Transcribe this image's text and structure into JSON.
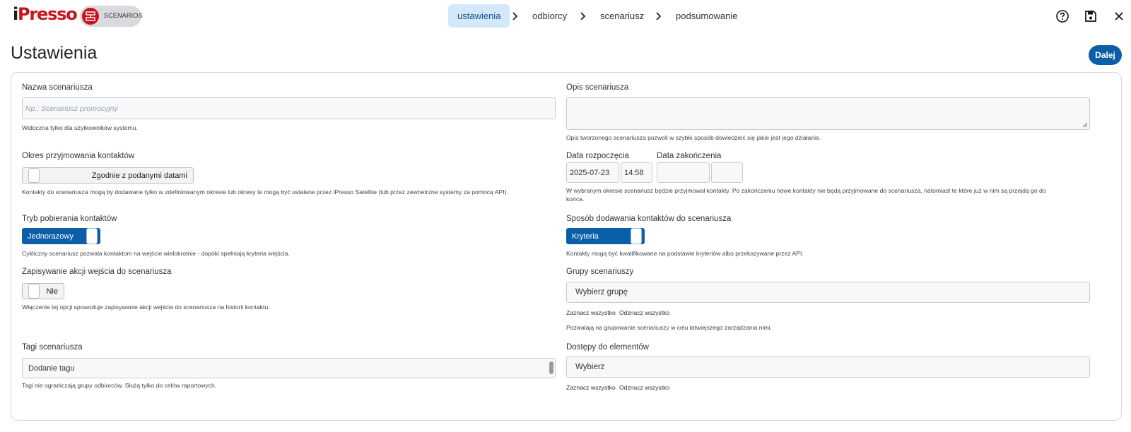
{
  "header": {
    "logo_i": "i",
    "logo_text": "Presso",
    "badge_label": "SCENARIOS",
    "steps": [
      {
        "label": "ustawienia",
        "active": true
      },
      {
        "label": "odbiorcy",
        "active": false
      },
      {
        "label": "scenariusz",
        "active": false
      },
      {
        "label": "podsumowanie",
        "active": false
      }
    ],
    "icons": [
      "help-icon",
      "save-icon",
      "close-icon"
    ]
  },
  "page": {
    "title": "Ustawienia",
    "next_label": "Dalej"
  },
  "form": {
    "name": {
      "label": "Nazwa scenariusza",
      "placeholder": "Np.: Scenariusz promocyjny",
      "hint": "Widoczna tylko dla użytkowników systemu."
    },
    "description": {
      "label": "Opis scenariusza",
      "hint": "Opis tworzonego scenariusza pozwoli w szybki sposób dowiedzieć się jakie jest jego działanie."
    },
    "period": {
      "label": "Okres przyjmowania kontaktów",
      "toggle_text": "Zgodnie z podanymi datami",
      "hint": "Kontakty do scenariusza mogą by dodawane tylko w zdefiniowanym okresie lub okresy te mogą być ustalane przez iPresso Satellite (lub przez zewnetrzne systemy za pomocą API)."
    },
    "dates": {
      "start_label": "Data rozpoczęcia",
      "end_label": "Data zakończenia",
      "start_date": "2025-07-23",
      "start_time": "14:58",
      "end_date": "",
      "end_time": "",
      "hint_line1": "W wybranym okresie scenariusz będzie przyjmował kontakty. Po zakończeniu nowe kontakty nie będą przyjmowane do scenariusza, natomiast te które już w nim są przejdą go do",
      "hint_line2": "końca."
    },
    "mode": {
      "label": "Tryb pobierania kontaktów",
      "toggle_text": "Jednorazowy",
      "hint": "Cykliczny scenariusz pozwala kontaktom na wejście wielokrotnie - dopóki spełniają kryteria wejścia."
    },
    "add_method": {
      "label": "Sposób dodawania kontaktów do scenariusza",
      "toggle_text": "Kryteria",
      "hint": "Kontakty mogą być kwalifikowane na podstawie kryteriów albo przekazywane przez API."
    },
    "save_actions": {
      "label": "Zapisywanie akcji wejścia do scenariusza",
      "toggle_text": "Nie",
      "hint": "Włączenie tej opcji spowoduje zapisywanie akcji wejścia do scenariusza na historii kontaktu."
    },
    "groups": {
      "label": "Grupy scenariuszy",
      "select_text": "Wybierz grupę",
      "select_all": "Zaznacz wszystko",
      "deselect_all": "Odznacz wszystko",
      "hint": "Pozwalają na grupowanie scenariuszy w celu łatwiejszego zarządzania nimi."
    },
    "tags": {
      "label": "Tagi scenariusza",
      "input_text": "Dodanie tagu",
      "hint": "Tagi nie ograniczają grupy odbiorców. Służą tylko do celów raportowych."
    },
    "access": {
      "label": "Dostępy do elementów",
      "select_text": "Wybierz",
      "select_all": "Zaznacz wszystko",
      "deselect_all": "Odznacz wszystko"
    }
  },
  "colors": {
    "primary": "#0b5ea8",
    "active_step_bg": "#d4e8fb",
    "brand_red": "#c8141e"
  }
}
